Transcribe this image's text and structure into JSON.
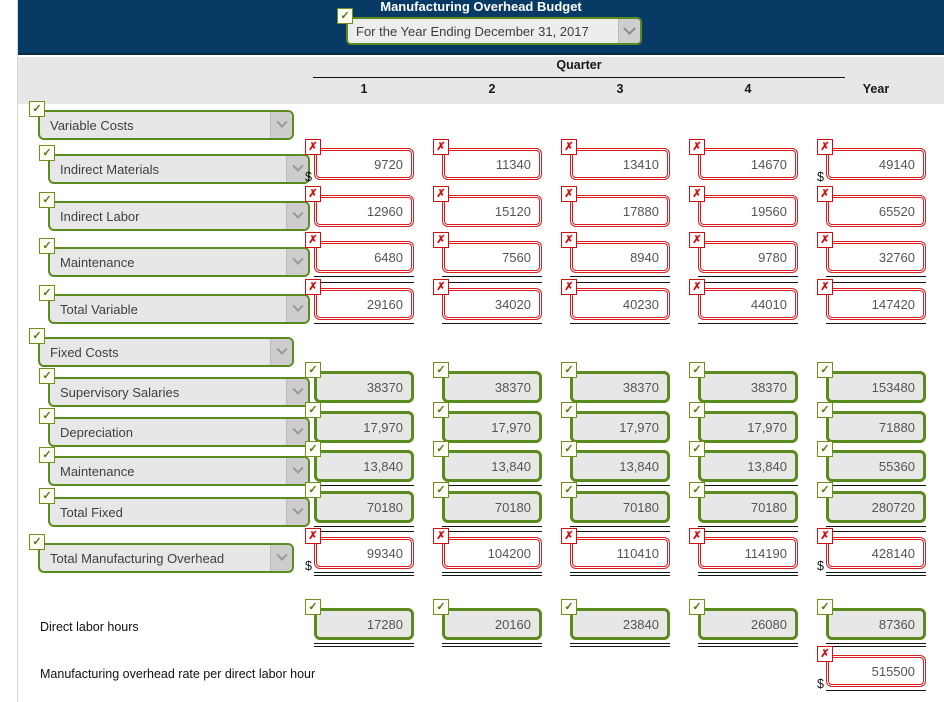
{
  "header": {
    "title": "Manufacturing Overhead Budget",
    "period_select": {
      "value": "For the Year Ending December 31, 2017",
      "icon": "chevron-down-icon",
      "badge": "✓"
    },
    "bg_color": "#083a66"
  },
  "columns": {
    "group_label": "Quarter",
    "quarter_headers": [
      "1",
      "2",
      "3",
      "4"
    ],
    "year_header": "Year"
  },
  "badges": {
    "ok": "✓",
    "bad": "✗"
  },
  "currency_symbol": "$",
  "section_labels": {
    "variable": "Variable Costs",
    "fixed": "Fixed Costs",
    "total_overhead": "Total Manufacturing Overhead"
  },
  "rows": [
    {
      "name": "variable-costs-header",
      "label": "Variable Costs",
      "kind": "section",
      "indent": 0,
      "status": "ok"
    },
    {
      "name": "indirect-materials",
      "label": "Indirect Materials",
      "kind": "line",
      "indent": 1,
      "status": "ok",
      "cell_status": "bad",
      "dollar": true,
      "values": [
        "9720",
        "11340",
        "13410",
        "14670",
        "49140"
      ]
    },
    {
      "name": "indirect-labor",
      "label": "Indirect Labor",
      "kind": "line",
      "indent": 1,
      "status": "ok",
      "cell_status": "bad",
      "dollar": false,
      "values": [
        "12960",
        "15120",
        "17880",
        "19560",
        "65520"
      ]
    },
    {
      "name": "maintenance-variable",
      "label": "Maintenance",
      "kind": "line",
      "indent": 1,
      "status": "ok",
      "cell_status": "bad",
      "dollar": false,
      "values": [
        "6480",
        "7560",
        "8940",
        "9780",
        "32760"
      ],
      "rule_below": "single"
    },
    {
      "name": "total-variable",
      "label": "Total Variable",
      "kind": "line",
      "indent": 1,
      "status": "ok",
      "cell_status": "bad",
      "dollar": false,
      "values": [
        "29160",
        "34020",
        "40230",
        "44010",
        "147420"
      ],
      "rule_below": "single"
    },
    {
      "name": "fixed-costs-header",
      "label": "Fixed Costs",
      "kind": "section",
      "indent": 0,
      "status": "ok"
    },
    {
      "name": "supervisory-salaries",
      "label": "Supervisory Salaries",
      "kind": "line",
      "indent": 1,
      "status": "ok",
      "cell_status": "ok",
      "dollar": false,
      "values": [
        "38370",
        "38370",
        "38370",
        "38370",
        "153480"
      ]
    },
    {
      "name": "depreciation",
      "label": "Depreciation",
      "kind": "line",
      "indent": 1,
      "status": "ok",
      "cell_status": "ok",
      "dollar": false,
      "values": [
        "17,970",
        "17,970",
        "17,970",
        "17,970",
        "71880"
      ]
    },
    {
      "name": "maintenance-fixed",
      "label": "Maintenance",
      "kind": "line",
      "indent": 1,
      "status": "ok",
      "cell_status": "ok",
      "dollar": false,
      "values": [
        "13,840",
        "13,840",
        "13,840",
        "13,840",
        "55360"
      ],
      "rule_below": "single"
    },
    {
      "name": "total-fixed",
      "label": "Total Fixed",
      "kind": "line",
      "indent": 1,
      "status": "ok",
      "cell_status": "ok",
      "dollar": false,
      "values": [
        "70180",
        "70180",
        "70180",
        "70180",
        "280720"
      ],
      "rule_below": "single"
    },
    {
      "name": "total-manufacturing-overhead",
      "label": "Total Manufacturing Overhead",
      "kind": "section",
      "indent": 0,
      "status": "ok",
      "cell_status": "bad",
      "dollar": true,
      "values": [
        "99340",
        "104200",
        "110410",
        "114190",
        "428140"
      ],
      "rule_below": "double"
    },
    {
      "name": "direct-labor-hours",
      "label": "Direct labor hours",
      "kind": "plain",
      "cell_status": "ok",
      "dollar": false,
      "values": [
        "17280",
        "20160",
        "23840",
        "26080",
        "87360"
      ],
      "rule_below": "double"
    },
    {
      "name": "manufacturing-overhead-rate",
      "label": "Manufacturing overhead rate per direct labor hour",
      "kind": "plain",
      "cell_status": "bad",
      "dollar": true,
      "values": [
        "",
        "",
        "",
        "",
        "515500"
      ],
      "rule_below": "single"
    }
  ]
}
